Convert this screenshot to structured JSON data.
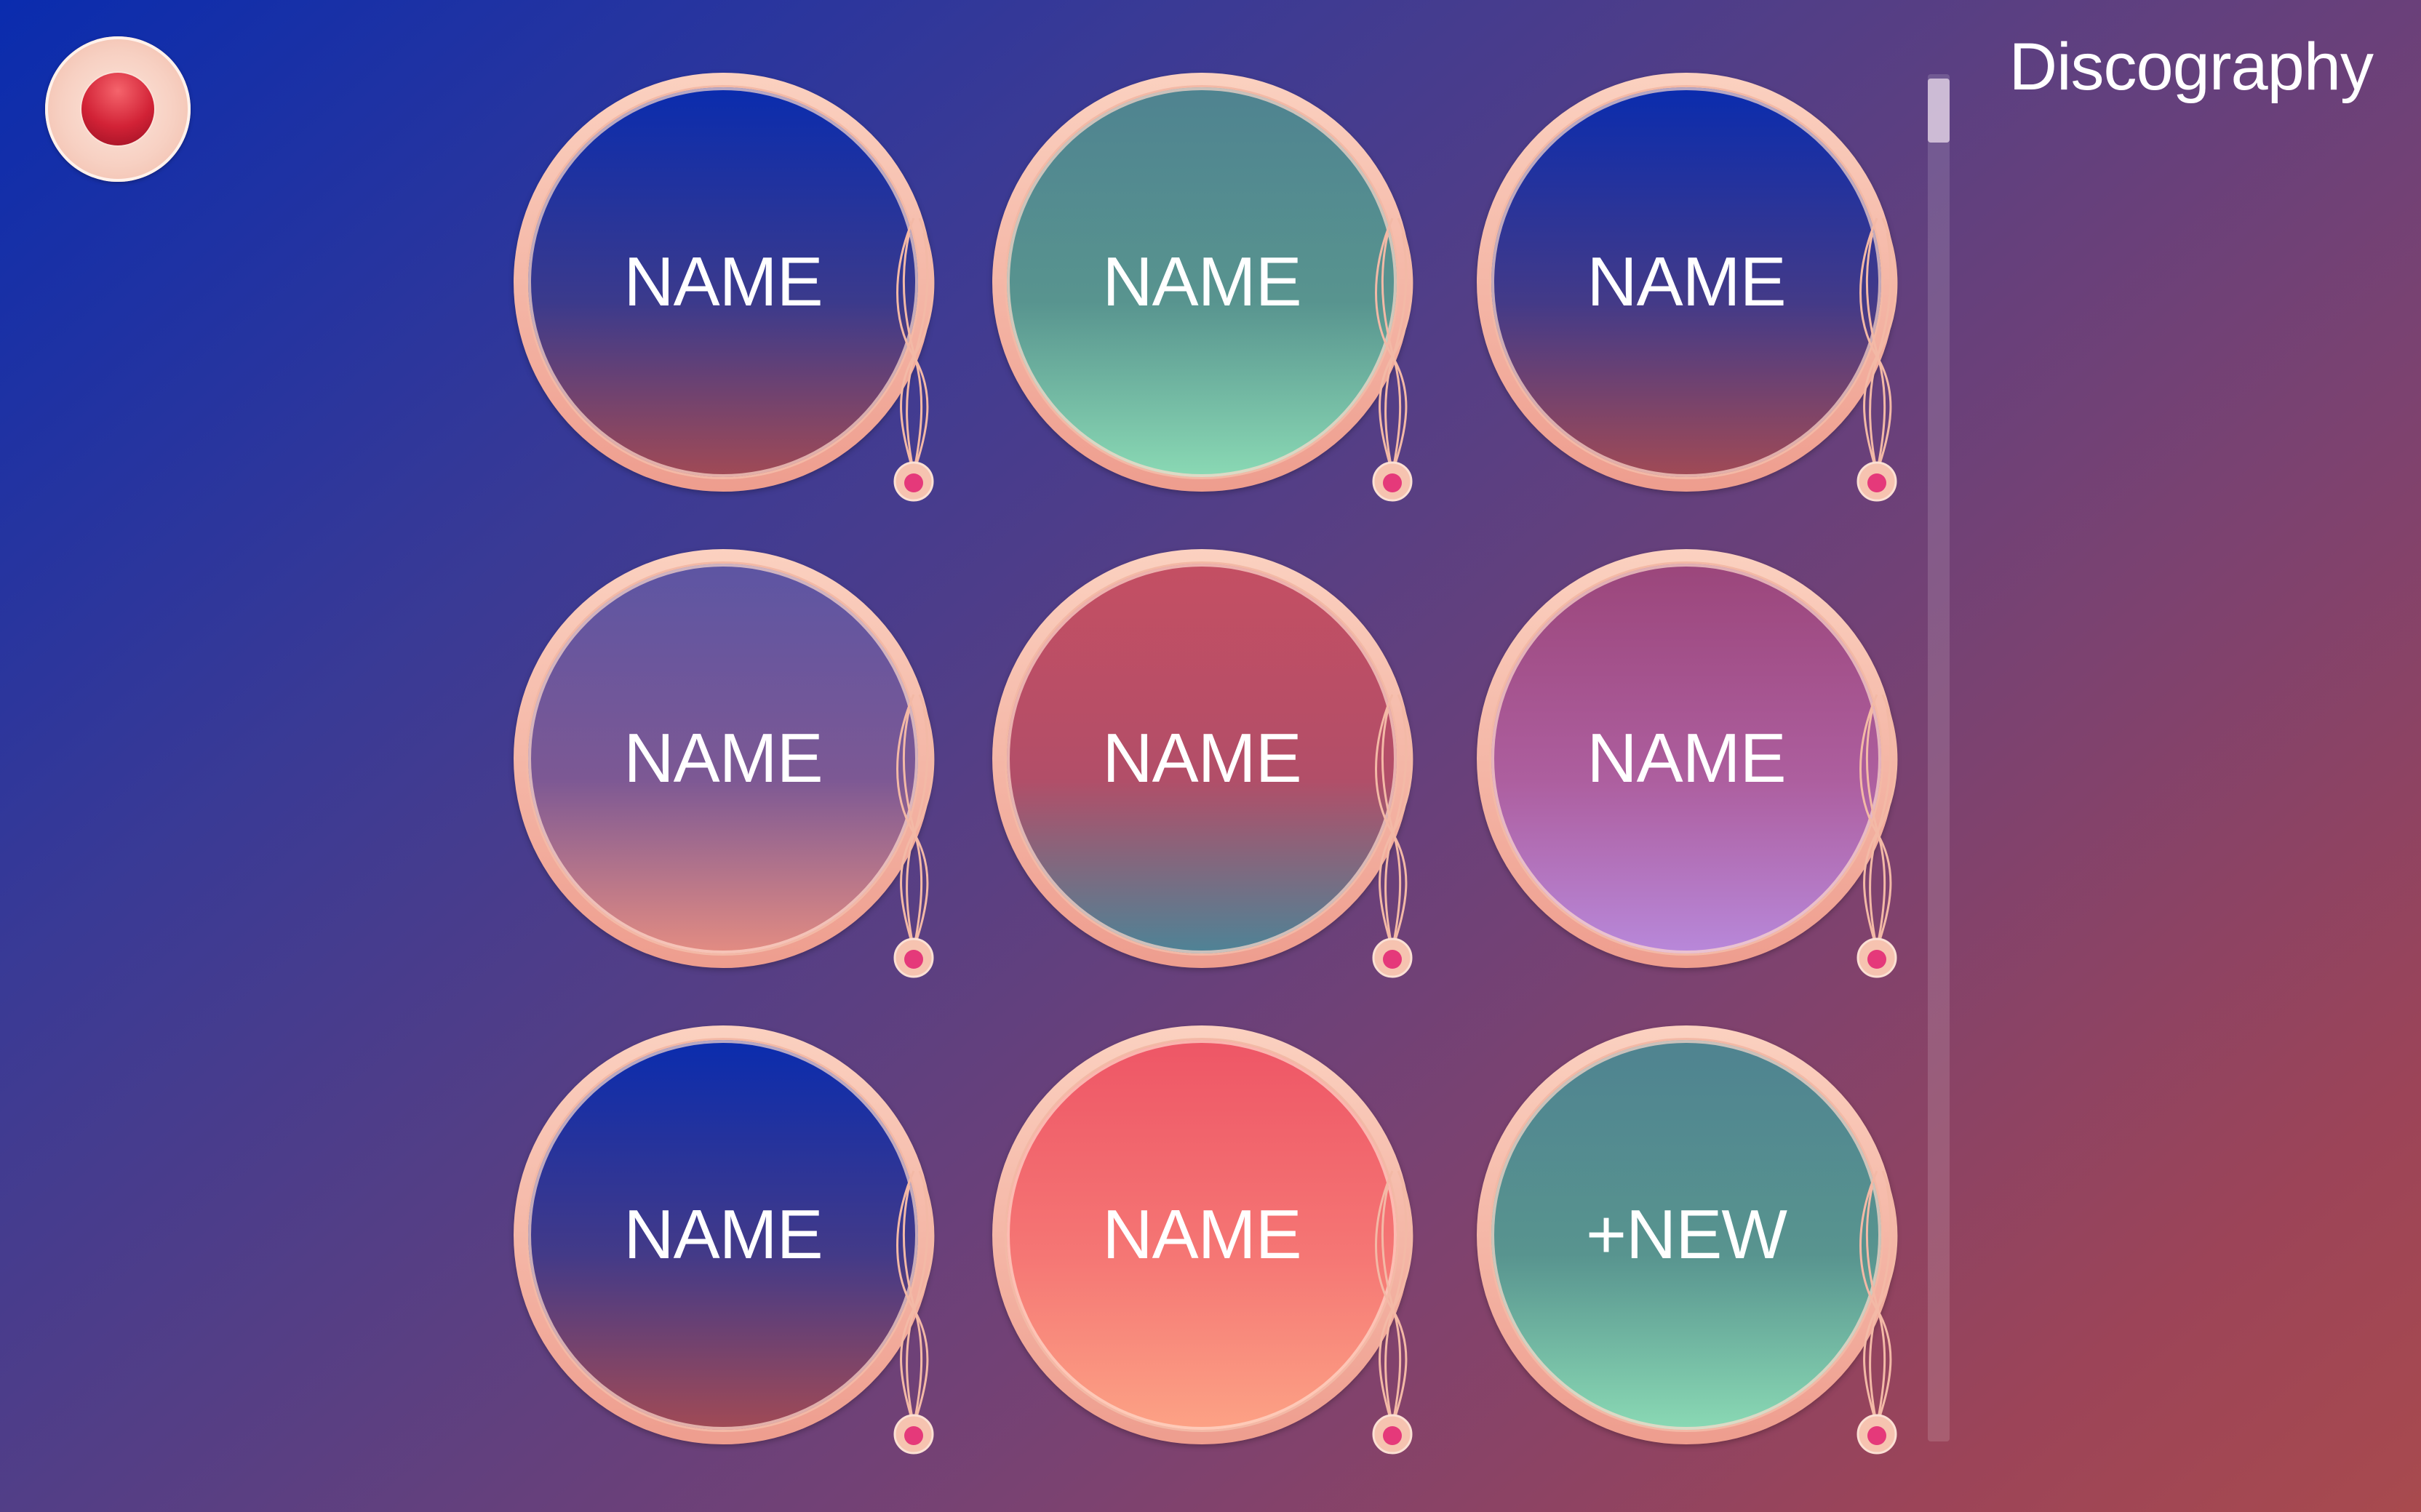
{
  "header": {
    "title": "Discography"
  },
  "record_button": {
    "icon": "record-icon"
  },
  "albums": [
    {
      "label": "NAME",
      "gradient": [
        "#0a2cae",
        "#3b3a8c",
        "#a14a55"
      ]
    },
    {
      "label": "NAME",
      "gradient": [
        "#4f8390",
        "#58948f",
        "#8ad9b4"
      ]
    },
    {
      "label": "NAME",
      "gradient": [
        "#0a2cae",
        "#433a88",
        "#a14a55"
      ]
    },
    {
      "label": "NAME",
      "gradient": [
        "#5d55a3",
        "#7c5894",
        "#e38c82"
      ]
    },
    {
      "label": "NAME",
      "gradient": [
        "#c44f63",
        "#b24e68",
        "#4e8396"
      ]
    },
    {
      "label": "NAME",
      "gradient": [
        "#9b467b",
        "#ad5e9e",
        "#b888da"
      ]
    },
    {
      "label": "NAME",
      "gradient": [
        "#0a2cae",
        "#433a88",
        "#a14a55"
      ]
    },
    {
      "label": "NAME",
      "gradient": [
        "#ee5666",
        "#f57674",
        "#fca285"
      ]
    },
    {
      "label": "+NEW",
      "gradient": [
        "#4f8390",
        "#58948f",
        "#8ad9b4"
      ]
    }
  ],
  "colors": {
    "background_start": "#0a2cae",
    "background_end": "#a84a4e",
    "ring": "#f3b9a6",
    "accent": "#e5397a"
  }
}
